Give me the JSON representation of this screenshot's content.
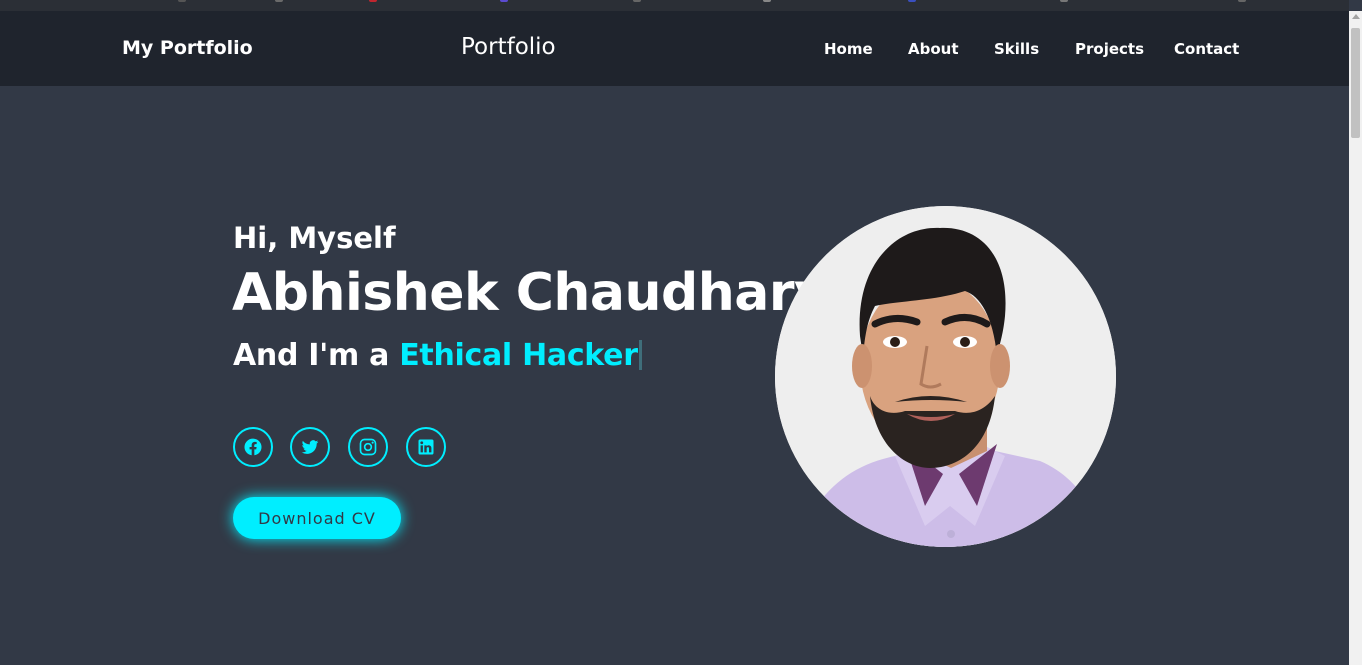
{
  "header": {
    "logo": "My Portfolio",
    "brand": "Portfolio",
    "nav": [
      "Home",
      "About",
      "Skills",
      "Projects",
      "Contact"
    ]
  },
  "hero": {
    "greeting": "Hi, Myself",
    "name": "Abhishek Chaudhary",
    "role_prefix": "And I'm a ",
    "role_highlight": "Ethical Hacker",
    "download_label": "Download CV"
  },
  "social": [
    "facebook-icon",
    "twitter-icon",
    "instagram-icon",
    "linkedin-icon"
  ],
  "colors": {
    "background": "#323946",
    "header": "#1f242d",
    "accent": "#00eeff",
    "text": "#ffffff"
  }
}
